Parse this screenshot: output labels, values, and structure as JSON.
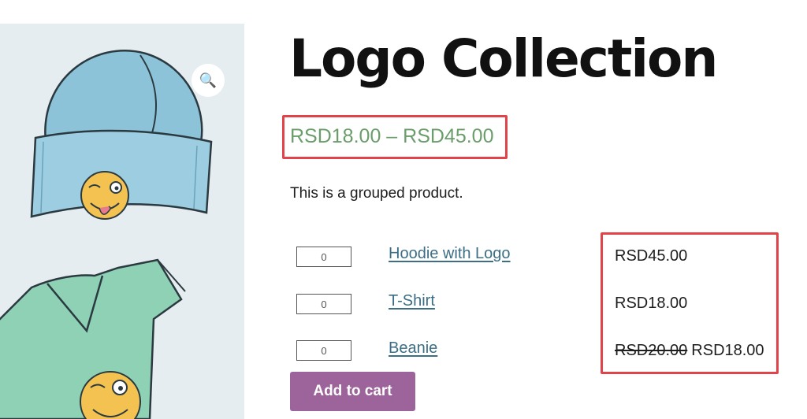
{
  "product": {
    "title": "Logo Collection",
    "price_range": "RSD18.00 – RSD45.00",
    "short_description": "This is a grouped product."
  },
  "gallery": {
    "zoom_icon": "magnifier-icon",
    "zoom_glyph": "🔍"
  },
  "grouped_items": [
    {
      "qty": "0",
      "name": "Hoodie with Logo",
      "price": "RSD45.00",
      "regular_price": ""
    },
    {
      "qty": "0",
      "name": "T-Shirt",
      "price": "RSD18.00",
      "regular_price": ""
    },
    {
      "qty": "0",
      "name": "Beanie",
      "price": "RSD18.00",
      "regular_price": "RSD20.00"
    }
  ],
  "actions": {
    "add_to_cart": "Add to cart"
  },
  "colors": {
    "price_green": "#6b9d6b",
    "link_blue": "#3c6e85",
    "button_purple": "#9d649c",
    "highlight_red": "#e0444a"
  }
}
